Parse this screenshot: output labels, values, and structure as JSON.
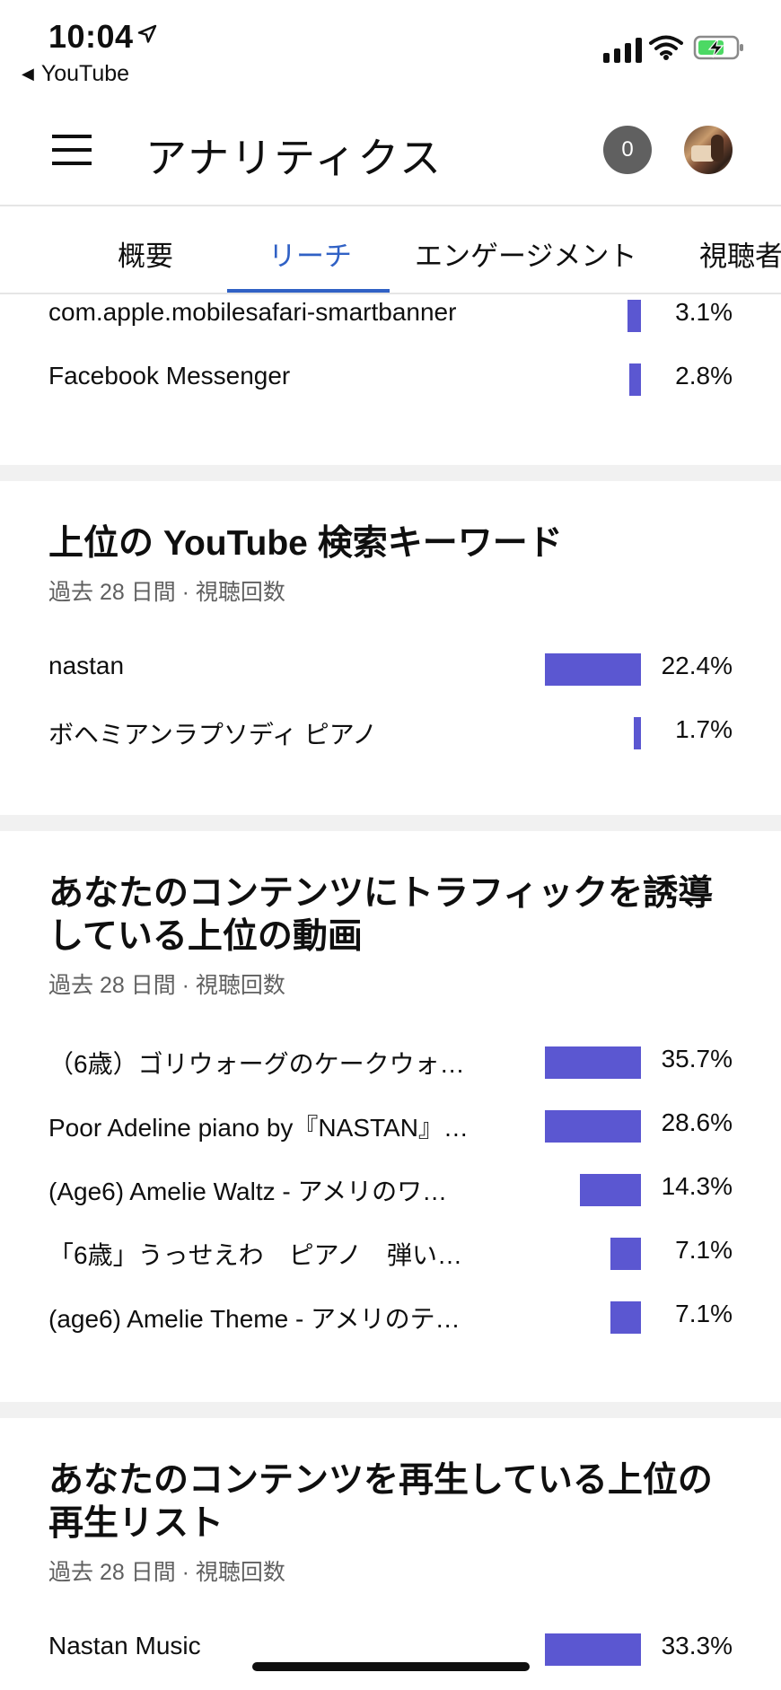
{
  "status_bar": {
    "time": "10:04",
    "back_app": "YouTube"
  },
  "header": {
    "title": "アナリティクス",
    "notification_count": "0"
  },
  "tabs": [
    {
      "label": "概要"
    },
    {
      "label": "リーチ"
    },
    {
      "label": "エンゲージメント"
    },
    {
      "label": "視聴者"
    }
  ],
  "external": {
    "rows": [
      {
        "label": "com.apple.mobilesafari-smartbanner",
        "pct": "3.1%",
        "share": 3.1
      },
      {
        "label": "Facebook Messenger",
        "pct": "2.8%",
        "share": 2.8
      }
    ]
  },
  "search_keywords": {
    "title": "上位の YouTube 検索キーワード",
    "subtitle": "過去 28 日間 · 視聴回数",
    "rows": [
      {
        "label": "nastan",
        "pct": "22.4%",
        "share": 22.4
      },
      {
        "label": "ボヘミアンラプソディ ピアノ",
        "pct": "1.7%",
        "share": 1.7
      }
    ]
  },
  "top_videos": {
    "title": "あなたのコンテンツにトラフィックを誘導している上位の動画",
    "subtitle": "過去 28 日間 · 視聴回数",
    "rows": [
      {
        "label": "（6歳）ゴリウォーグのケークウォ…",
        "pct": "35.7%",
        "share": 35.7
      },
      {
        "label": "Poor Adeline piano by『NASTAN』…",
        "pct": "28.6%",
        "share": 28.6
      },
      {
        "label": "(Age6) Amelie Waltz  - アメリのワ…",
        "pct": "14.3%",
        "share": 14.3
      },
      {
        "label": "「6歳」うっせえわ　ピアノ　弾い…",
        "pct": "7.1%",
        "share": 7.1
      },
      {
        "label": "(age6) Amelie Theme - アメリのテ…",
        "pct": "7.1%",
        "share": 7.1
      }
    ]
  },
  "top_playlists": {
    "title": "あなたのコンテンツを再生している上位の再生リスト",
    "subtitle": "過去 28 日間 · 視聴回数",
    "rows": [
      {
        "label": "Nastan Music",
        "pct": "33.3%",
        "share": 33.3
      }
    ]
  },
  "colors": {
    "accent": "#3061c5",
    "bar": "#5b57d1",
    "notification_badge": "#606060",
    "divider": "#f1f1f1"
  },
  "icons": [
    "location-arrow-icon",
    "back-triangle-icon",
    "signal-icon",
    "wifi-icon",
    "battery-charging-icon",
    "menu-icon"
  ]
}
